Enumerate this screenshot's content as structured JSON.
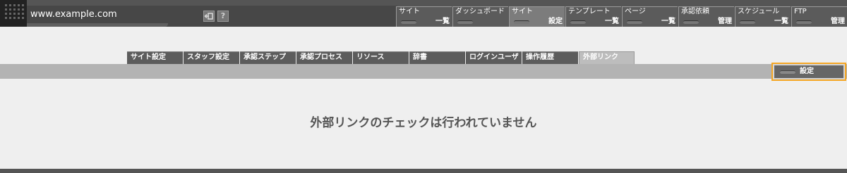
{
  "header": {
    "site_url": "www.example.com",
    "back_icon": "exit-icon",
    "help_icon_char": "?"
  },
  "nav": [
    {
      "top": "サイト",
      "bottom": "一覧"
    },
    {
      "top": "ダッシュボード",
      "bottom": ""
    },
    {
      "top": "サイト",
      "bottom": "設定",
      "current": true
    },
    {
      "top": "テンプレート",
      "bottom": "一覧"
    },
    {
      "top": "ページ",
      "bottom": "一覧"
    },
    {
      "top": "承認依頼",
      "bottom": "管理"
    },
    {
      "top": "スケジュール",
      "bottom": "一覧"
    },
    {
      "top": "FTP",
      "bottom": "管理"
    }
  ],
  "tabs": [
    {
      "label": "サイト設定"
    },
    {
      "label": "スタッフ設定"
    },
    {
      "label": "承認ステップ"
    },
    {
      "label": "承認プロセス"
    },
    {
      "label": "リソース"
    },
    {
      "label": "辞書"
    },
    {
      "label": "ログインユーザ"
    },
    {
      "label": "操作履歴"
    },
    {
      "label": "外部リンク",
      "active": true
    }
  ],
  "toolbar": {
    "settings_label": "設定"
  },
  "main": {
    "message": "外部リンクのチェックは行われていません"
  },
  "colors": {
    "highlight": "#f5a623",
    "topbar": "#555555"
  }
}
